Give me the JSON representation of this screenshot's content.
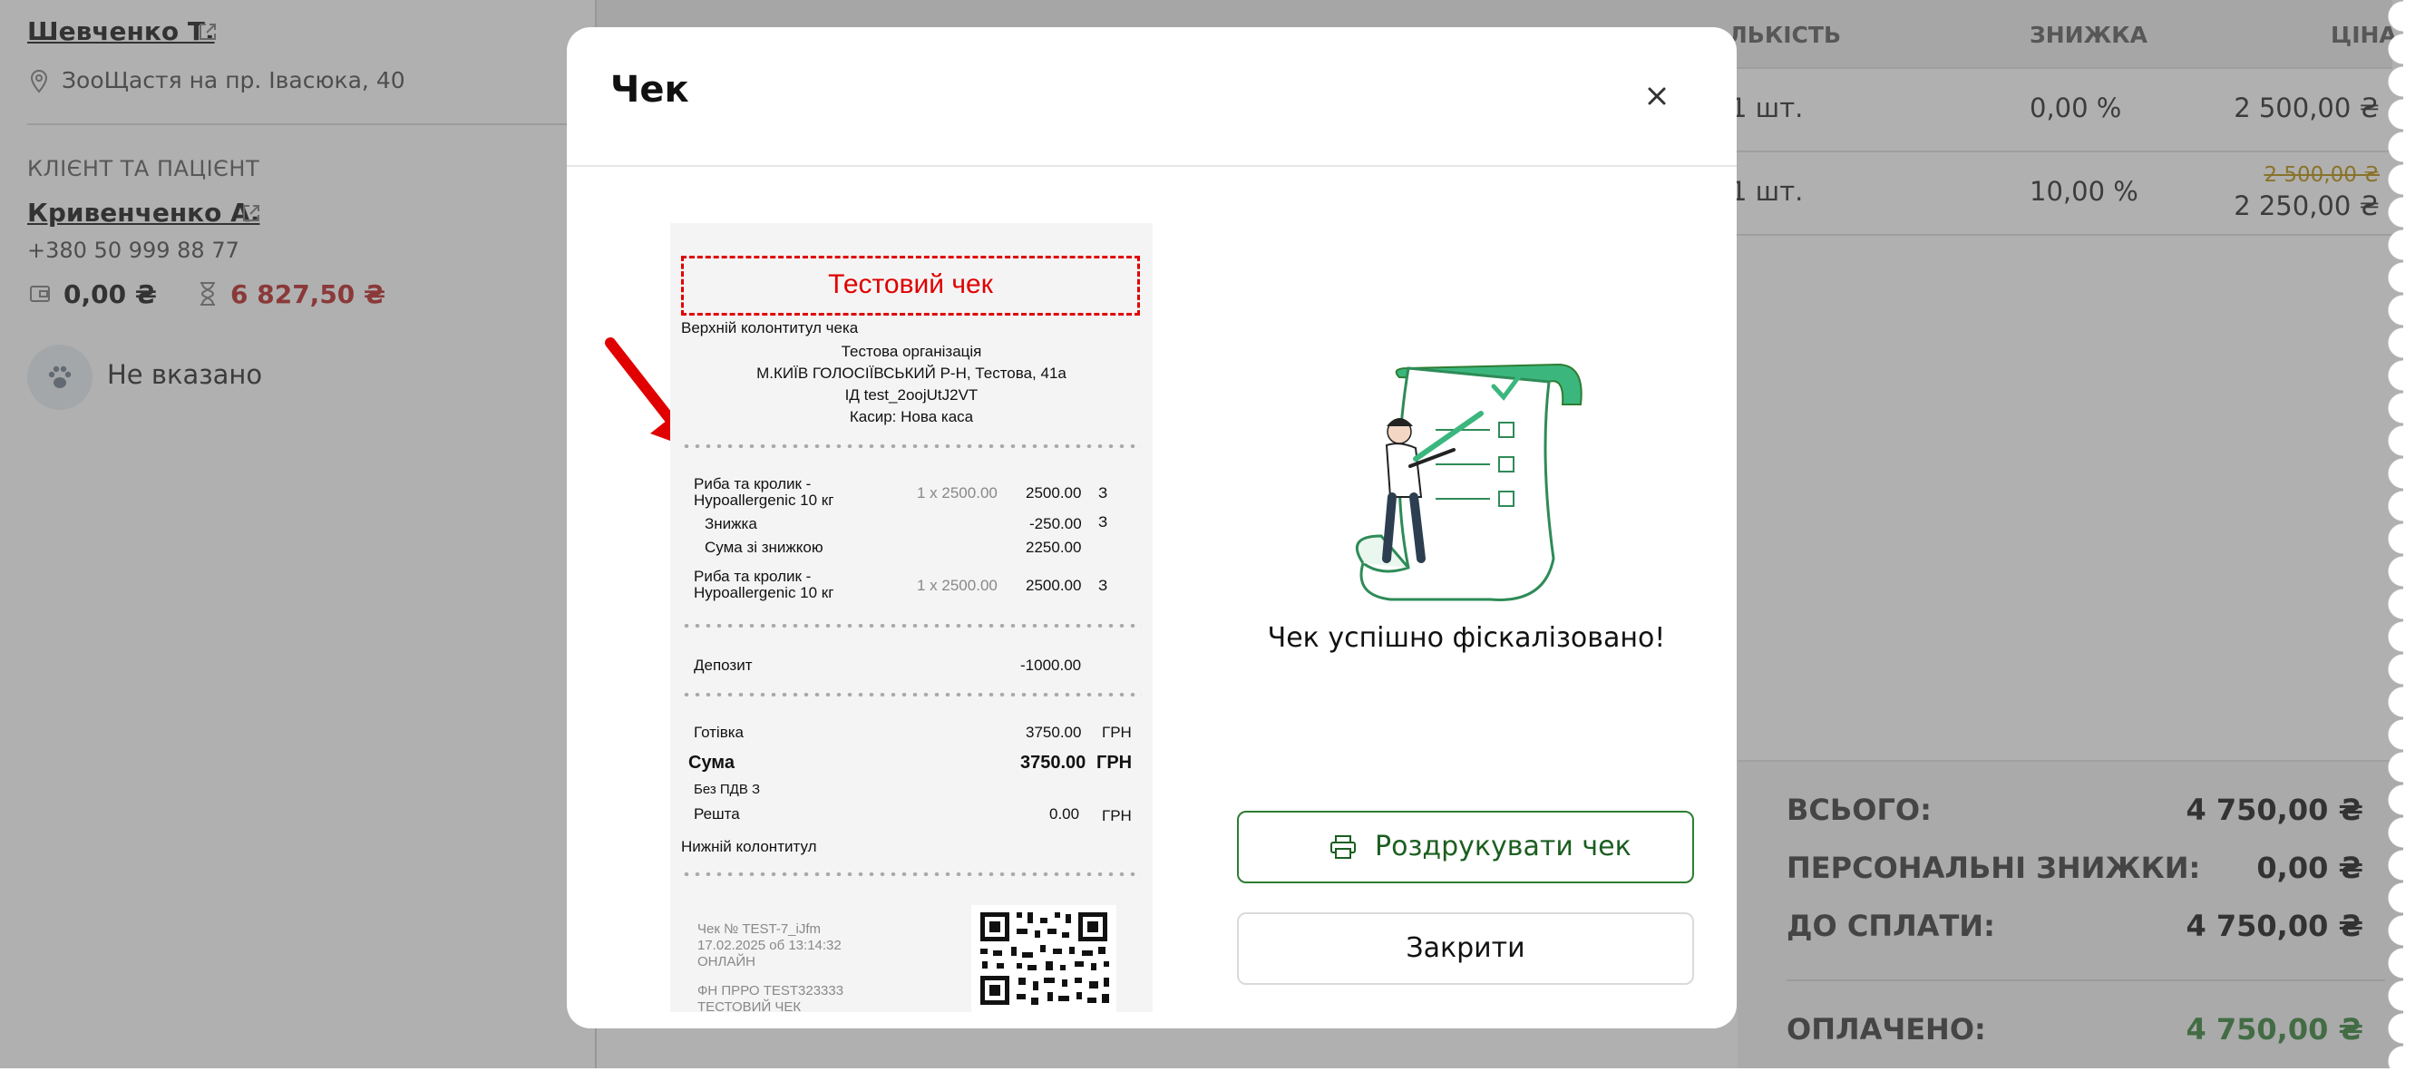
{
  "doctor": {
    "name": "Шевченко Т.",
    "clinic": "ЗооЩастя на пр. Івасюка, 40"
  },
  "client": {
    "section_title": "КЛІЄНТ ТА ПАЦІЄНТ",
    "name": "Кривенченко А.",
    "phone": "+380 50 999 88 77",
    "balance": "0,00 ₴",
    "debt": "6 827,50 ₴",
    "pet": "Не вказано"
  },
  "table": {
    "headers": {
      "qty": "ЛЬКІСТЬ",
      "discount": "ЗНИЖКА",
      "price": "ЦІНА"
    },
    "rows": [
      {
        "qty": "1 шт.",
        "discount": "0,00 %",
        "price": "2 500,00 ₴",
        "old_price": ""
      },
      {
        "qty": "1 шт.",
        "discount": "10,00 %",
        "price": "2 250,00 ₴",
        "old_price": "2 500,00 ₴"
      }
    ]
  },
  "summary": {
    "total_label": "ВСЬОГО:",
    "total": "4 750,00 ₴",
    "personal_label": "ПЕРСОНАЛЬНІ ЗНИЖКИ:",
    "personal": "0,00 ₴",
    "due_label": "ДО СПЛАТИ:",
    "due": "4 750,00 ₴",
    "paid_label": "ОПЛАЧЕНО:",
    "paid": "4 750,00 ₴"
  },
  "colors": {
    "debt": "#b71c1c",
    "paid": "#2e7d32",
    "accent": "#2e7d32",
    "test_mark": "#e00000"
  },
  "modal": {
    "title": "Чек",
    "success_text": "Чек успішно фіскалізовано!",
    "print_label": "Роздрукувати чек",
    "close_label": "Закрити"
  },
  "receipt": {
    "test_label": "Тестовий чек",
    "header": "Верхній колонтитул чека",
    "org": "Тестова організація",
    "address": "М.КИЇВ ГОЛОСІЇВСЬКИЙ Р-Н, Тестова, 41а",
    "id": "ІД test_2oojUtJ2VT",
    "cashier": "Касир: Нова каса",
    "item1_l1": "Риба та кролик -",
    "item1_l2": "Hypoallergenic 10 кг",
    "item1_qty": "1 x 2500.00",
    "item1_sum": "2500.00",
    "item1_tax": "З",
    "discount_label": "Знижка",
    "discount_value": "-250.00",
    "discount_tax": "З",
    "after_discount_label": "Сума зі знижкою",
    "after_discount_value": "2250.00",
    "item2_l1": "Риба та кролик -",
    "item2_l2": "Hypoallergenic 10 кг",
    "item2_qty": "1 x 2500.00",
    "item2_sum": "2500.00",
    "item2_tax": "З",
    "deposit_label": "Депозит",
    "deposit_value": "-1000.00",
    "cash_label": "Готівка",
    "cash_value": "3750.00",
    "currency": "ГРН",
    "sum_label": "Сума",
    "sum_value": "3750.00",
    "vat": "Без ПДВ З",
    "change_label": "Решта",
    "change_value": "0.00",
    "footer": "Нижній колонтитул",
    "check_no": "Чек № TEST-7_iJfm",
    "datetime": "17.02.2025 об 13:14:32",
    "mode": "ОНЛАЙН",
    "fn": "ФН ПРРО TEST323333",
    "test_check": "ТЕСТОВИЙ ЧЕК"
  }
}
